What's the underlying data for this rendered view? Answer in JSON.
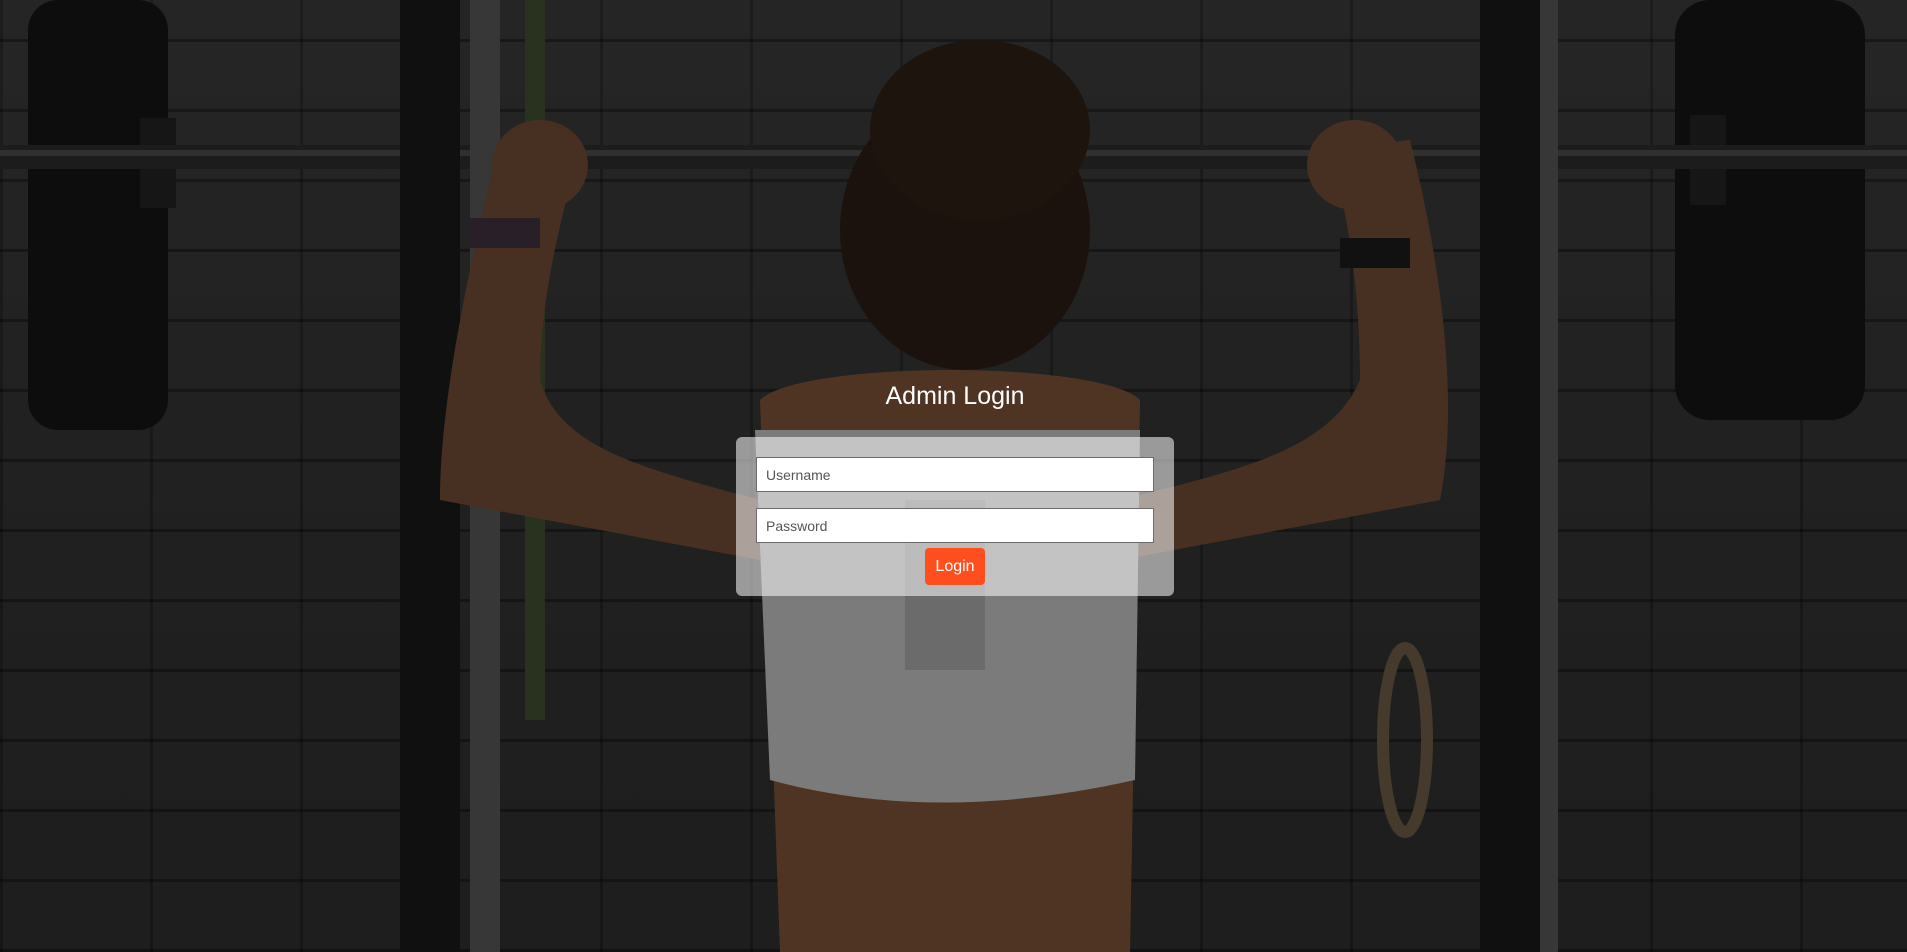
{
  "login": {
    "title": "Admin Login",
    "username_placeholder": "Username",
    "password_placeholder": "Password",
    "submit_label": "Login"
  },
  "colors": {
    "accent": "#ff4f1f",
    "title_text": "#ffffff"
  }
}
